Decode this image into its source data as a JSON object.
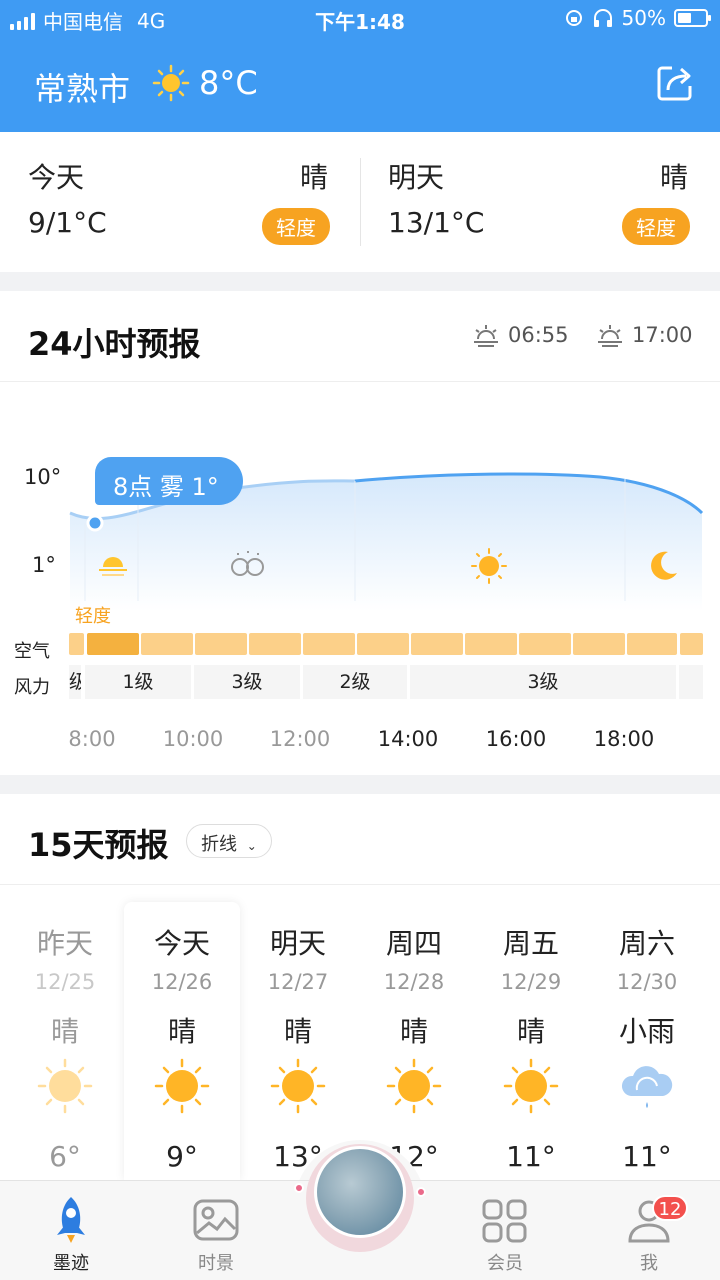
{
  "status": {
    "carrier": "中国电信",
    "network": "4G",
    "time": "下午1:48",
    "battery": "50%"
  },
  "header": {
    "city": "常熟市",
    "temperature": "8°C",
    "weather_icon": "sun-icon",
    "share_icon": "share-icon",
    "background": "#3f9bf3"
  },
  "summary": {
    "today": {
      "label": "今天",
      "condition": "晴",
      "range": "9/1°C",
      "air_quality": "轻度"
    },
    "tomorrow": {
      "label": "明天",
      "condition": "晴",
      "range": "13/1°C",
      "air_quality": "轻度"
    }
  },
  "hourly": {
    "title": "24小时预报",
    "sunrise": "06:55",
    "sunset": "17:00",
    "y_labels": [
      "10°",
      "1°"
    ],
    "tooltip": "8点 雾 1°",
    "aq_current": "轻度",
    "row_labels": {
      "air": "空气",
      "wind": "风力"
    },
    "wind": [
      {
        "label": "级"
      },
      {
        "label": "1级"
      },
      {
        "label": "3级"
      },
      {
        "label": "2级"
      },
      {
        "label": "3级"
      }
    ],
    "times": [
      "8:00",
      "10:00",
      "12:00",
      "14:00",
      "16:00",
      "18:00"
    ],
    "icons": [
      "sunrise-icon",
      "fog-icon",
      "sun-icon",
      "moon-icon"
    ]
  },
  "daily": {
    "title": "15天预报",
    "mode": "折线",
    "days": [
      {
        "name": "昨天",
        "date": "12/25",
        "cond": "晴",
        "icon": "sun-icon",
        "high": "6°"
      },
      {
        "name": "今天",
        "date": "12/26",
        "cond": "晴",
        "icon": "sun-icon",
        "high": "9°"
      },
      {
        "name": "明天",
        "date": "12/27",
        "cond": "晴",
        "icon": "sun-icon",
        "high": "13°"
      },
      {
        "name": "周四",
        "date": "12/28",
        "cond": "晴",
        "icon": "sun-icon",
        "high": "12°"
      },
      {
        "name": "周五",
        "date": "12/29",
        "cond": "晴",
        "icon": "sun-icon",
        "high": "11°"
      },
      {
        "name": "周六",
        "date": "12/30",
        "cond": "小雨",
        "icon": "cloud-rain-icon",
        "high": "11°"
      }
    ]
  },
  "tabs": [
    {
      "label": "墨迹",
      "icon": "rocket-icon",
      "selected": true
    },
    {
      "label": "时景",
      "icon": "photo-icon"
    },
    {
      "label": "会员",
      "icon": "grid-icon"
    },
    {
      "label": "我",
      "icon": "profile-icon",
      "badge": "12"
    }
  ]
}
